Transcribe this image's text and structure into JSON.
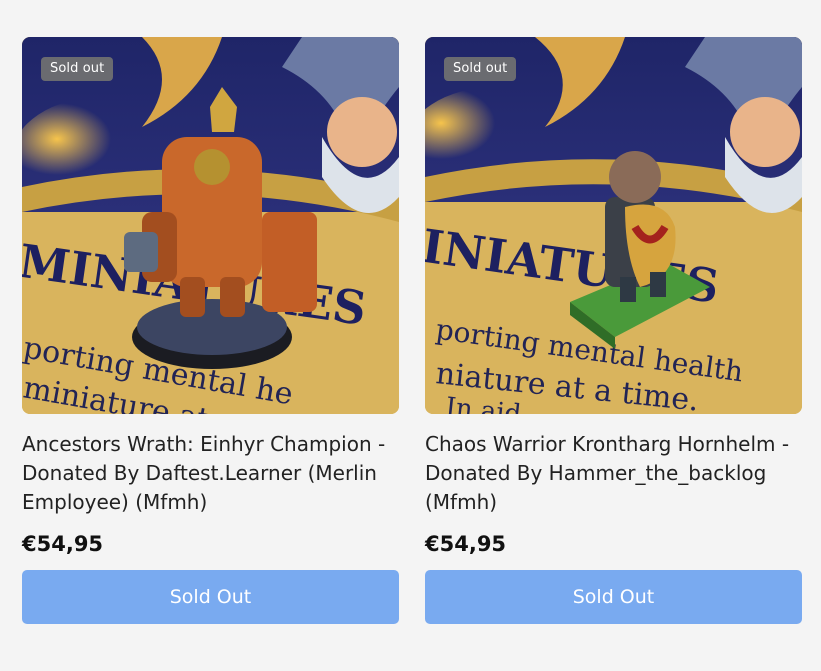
{
  "products": [
    {
      "badge": "Sold out",
      "title": "Ancestors Wrath: Einhyr Champion - Donated By Daftest.Learner (Merlin Employee) (Mfmh)",
      "price": "€54,95",
      "button_label": "Sold Out",
      "image_icon": "dwarf-champion-miniature-photo",
      "mat_text": [
        "MINIATURES",
        "porting mental he",
        "miniature at a ti"
      ]
    },
    {
      "badge": "Sold out",
      "title": "Chaos Warrior Krontharg Hornhelm - Donated By Hammer_the_backlog (Mfmh)",
      "price": "€54,95",
      "button_label": "Sold Out",
      "image_icon": "chaos-warrior-miniature-photo",
      "mat_text": [
        "INIATURES",
        "porting mental health",
        "niature at a time.",
        "In aid"
      ]
    }
  ],
  "colors": {
    "background": "#f4f4f4",
    "badge": "#717171",
    "button": "#79aaf0",
    "text": "#1c1c1c"
  }
}
